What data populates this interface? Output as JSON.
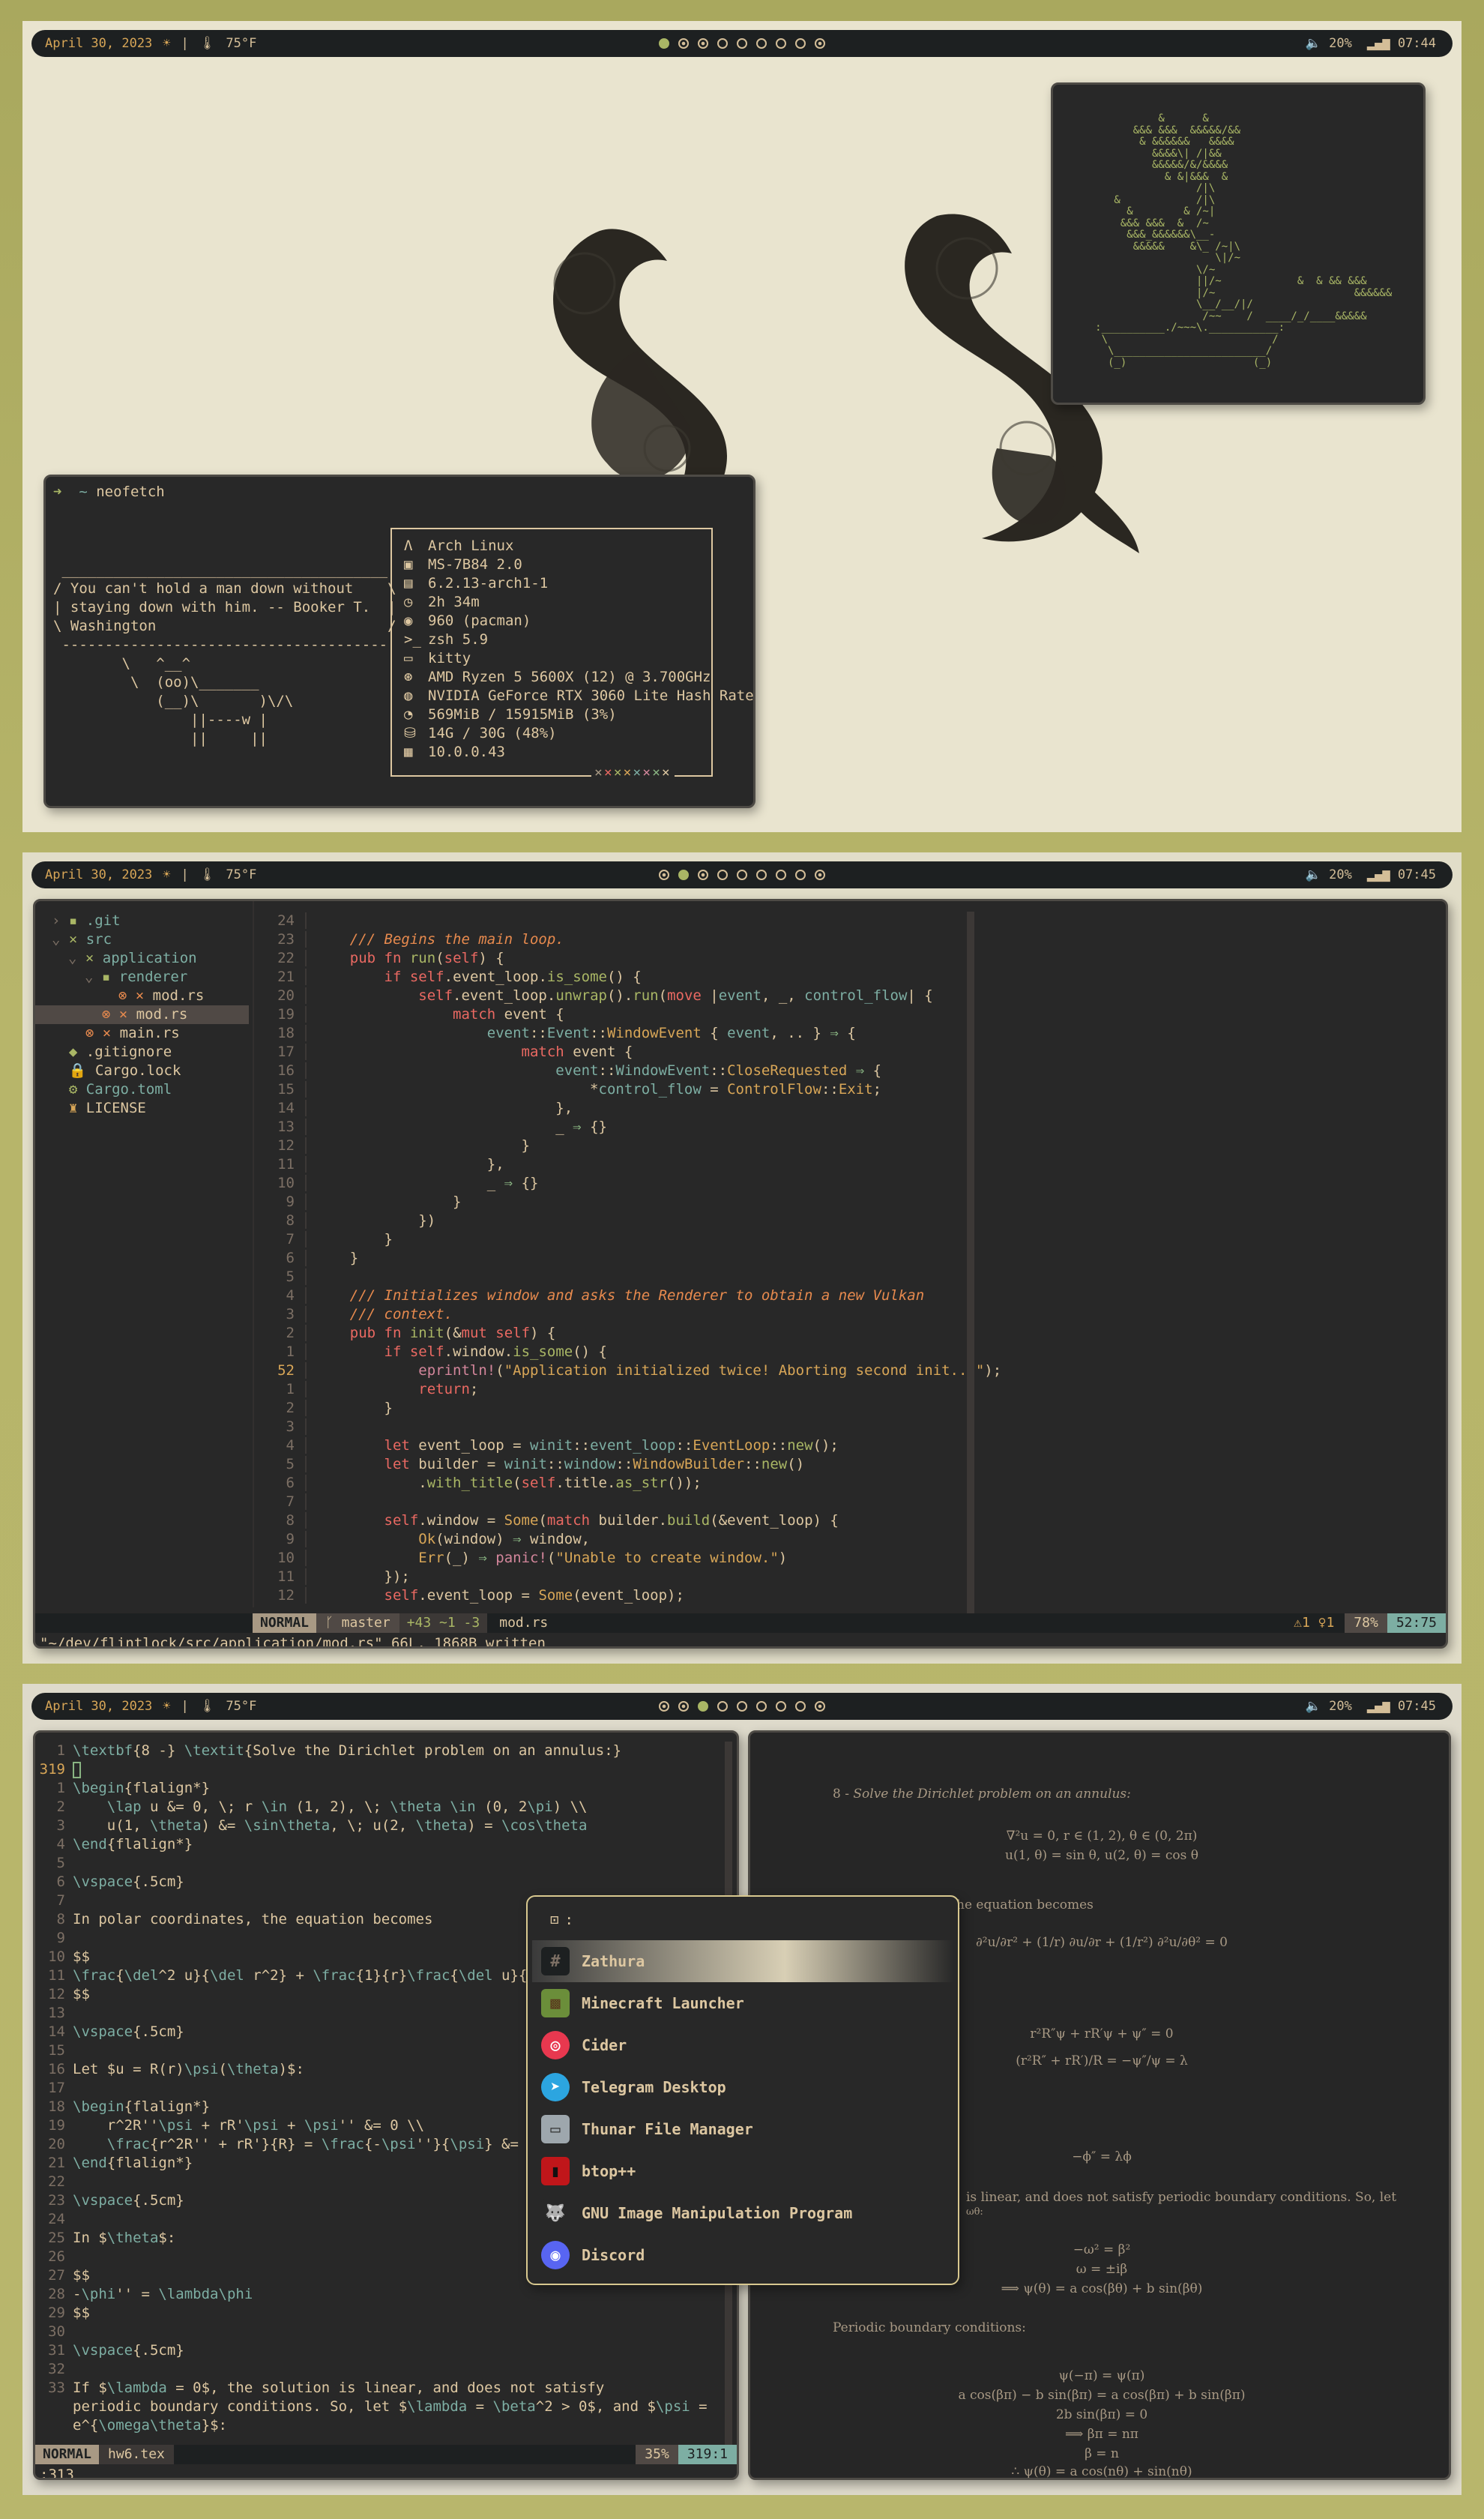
{
  "bar1": {
    "date": "April 30, 2023",
    "temp": "75°F",
    "volume": "20%",
    "time": "07:44"
  },
  "bar2": {
    "date": "April 30, 2023",
    "temp": "75°F",
    "volume": "20%",
    "time": "07:45"
  },
  "bar3": {
    "date": "April 30, 2023",
    "temp": "75°F",
    "volume": "20%",
    "time": "07:45"
  },
  "terminal": {
    "prompt": "➜  ~ neofetch",
    "cowsay": [
      " ______________________________________",
      "/ You can't hold a man down without    \\",
      "| staying down with him. -- Booker T.  |",
      "\\ Washington                           /",
      " --------------------------------------",
      "        \\   ^__^",
      "         \\  (oo)\\_______",
      "            (__)\\       )\\/\\",
      "                ||----w |",
      "                ||     ||"
    ],
    "info": [
      {
        "icon": "arch-icon",
        "glyph": "Λ",
        "text": "Arch Linux"
      },
      {
        "icon": "host-icon",
        "glyph": "▣",
        "text": "MS-7B84 2.0"
      },
      {
        "icon": "kernel-icon",
        "glyph": "▤",
        "text": "6.2.13-arch1-1"
      },
      {
        "icon": "clock-icon",
        "glyph": "◷",
        "text": "2h 34m"
      },
      {
        "icon": "package-icon",
        "glyph": "◉",
        "text": "960 (pacman)"
      },
      {
        "icon": "shell-icon",
        "glyph": ">_",
        "text": "zsh 5.9"
      },
      {
        "icon": "terminal-icon",
        "glyph": "▭",
        "text": "kitty"
      },
      {
        "icon": "cpu-icon",
        "glyph": "⊛",
        "text": "AMD Ryzen 5 5600X (12) @ 3.700GHz"
      },
      {
        "icon": "gpu-icon",
        "glyph": "◍",
        "text": "NVIDIA GeForce RTX 3060 Lite Hash Rate"
      },
      {
        "icon": "memory-icon",
        "glyph": "◔",
        "text": "569MiB / 15915MiB (3%)"
      },
      {
        "icon": "disk-icon",
        "glyph": "⛁",
        "text": "14G / 30G (48%)"
      },
      {
        "icon": "network-icon",
        "glyph": "▦",
        "text": "10.0.0.43"
      }
    ]
  },
  "bonsai": [
    "               &      &",
    "           &&& &&&  &&&&&/&&",
    "            & &&&&&&   &&&&",
    "              &&&&\\| /|&&",
    "              &&&&&/&/&&&&",
    "                & &|&&&  &",
    "                     /|\\",
    "        &            /|\\",
    "          &        & /~|",
    "         &&& &&&  &  /~",
    "          &&&_&&&&&&\\__-",
    "           &&&&&    &\\_ /~|\\",
    "                        \\|/~",
    "                     \\/~",
    "                     ||/~            &  & && &&&",
    "                     |/~                      &&&&&&",
    "                     \\__/__/|/",
    "                      /~~    /  ____/_/____&&&&&",
    "     :__________./~~~\\.___________:",
    "      \\                          /",
    "       \\________________________/",
    "       (_)                    (_)"
  ],
  "editor": {
    "tree": [
      {
        "indent": 1,
        "arrow": "›",
        "icon": "folder-icon",
        "glyph": "▪",
        "label": ".git",
        "color": "#7daea3"
      },
      {
        "indent": 1,
        "arrow": "⌄",
        "icon": "folder-open-icon",
        "glyph": "×",
        "label": "src",
        "color": "#7daea3"
      },
      {
        "indent": 2,
        "arrow": "⌄",
        "icon": "folder-open-icon",
        "glyph": "×",
        "label": "application",
        "color": "#7daea3"
      },
      {
        "indent": 3,
        "arrow": "⌄",
        "icon": "folder-open-icon",
        "glyph": "▪",
        "label": "renderer",
        "color": "#7daea3"
      },
      {
        "indent": 4,
        "arrow": "",
        "icon": "rust-file-icon",
        "glyph": "⊗ ×",
        "label": "mod.rs",
        "color": "#ddc7a1"
      },
      {
        "indent": 3,
        "arrow": "",
        "icon": "rust-file-icon",
        "glyph": "⊗ ×",
        "label": "mod.rs",
        "color": "#ddc7a1",
        "sel": true
      },
      {
        "indent": 2,
        "arrow": "",
        "icon": "rust-file-icon",
        "glyph": "⊗ ×",
        "label": "main.rs",
        "color": "#ddc7a1"
      },
      {
        "indent": 1,
        "arrow": "",
        "icon": "git-icon",
        "glyph": "◆",
        "label": ".gitignore",
        "color": "#ddc7a1"
      },
      {
        "indent": 1,
        "arrow": "",
        "icon": "lock-icon",
        "glyph": "🔒",
        "label": "Cargo.lock",
        "color": "#ddc7a1"
      },
      {
        "indent": 1,
        "arrow": "",
        "icon": "gear-icon",
        "glyph": "⚙",
        "label": "Cargo.toml",
        "color": "#7daea3"
      },
      {
        "indent": 1,
        "arrow": "",
        "icon": "license-icon",
        "glyph": "♜",
        "label": "LICENSE",
        "color": "#ddc7a1"
      }
    ],
    "lines": [
      {
        "n": "24",
        "h": ""
      },
      {
        "n": "23",
        "h": "    <span class='cm'>/// Begins the main loop.</span>"
      },
      {
        "n": "22",
        "h": "    <span class='kw'>pub fn</span> <span class='fn'>run</span>(<span class='kw'>self</span>) {"
      },
      {
        "n": "21",
        "h": "        <span class='kw'>if</span> <span class='kw'>self</span>.event_loop.<span class='fn'>is_some</span>() {"
      },
      {
        "n": "20",
        "h": "            <span class='kw'>self</span>.event_loop.<span class='fn'>unwrap</span>().<span class='fn'>run</span>(<span class='kw'>move</span> |<span class='vr'>event</span>, _, <span class='vr'>control_flow</span>| {"
      },
      {
        "n": "19",
        "h": "                <span class='kw'>match</span> event {"
      },
      {
        "n": "18",
        "h": "                    <span class='vr'>event</span>::<span class='vr'>Event</span>::<span class='ty'>WindowEvent</span> { <span class='vr'>event</span>, .. } <span class='op'>⇒</span> {"
      },
      {
        "n": "17",
        "h": "                        <span class='kw'>match</span> event {"
      },
      {
        "n": "16",
        "h": "                            <span class='vr'>event</span>::<span class='vr'>WindowEvent</span>::<span class='ty'>CloseRequested</span> <span class='op'>⇒</span> {"
      },
      {
        "n": "15",
        "h": "                                *<span class='vr'>control_flow</span> = <span class='ty'>ControlFlow</span>::<span class='ty'>Exit</span>;"
      },
      {
        "n": "14",
        "h": "                            },"
      },
      {
        "n": "13",
        "h": "                            _ <span class='op'>⇒</span> {}"
      },
      {
        "n": "12",
        "h": "                        }"
      },
      {
        "n": "11",
        "h": "                    },"
      },
      {
        "n": "10",
        "h": "                    _ <span class='op'>⇒</span> {}"
      },
      {
        "n": "9",
        "h": "                }"
      },
      {
        "n": "8",
        "h": "            })"
      },
      {
        "n": "7",
        "h": "        }"
      },
      {
        "n": "6",
        "h": "    }"
      },
      {
        "n": "5",
        "h": ""
      },
      {
        "n": "4",
        "h": "    <span class='cm'>/// Initializes window and asks the Renderer to obtain a new Vulkan</span>"
      },
      {
        "n": "3",
        "h": "    <span class='cm'>/// context.</span>"
      },
      {
        "n": "2",
        "h": "    <span class='kw'>pub fn</span> <span class='fn'>init</span>(&amp;<span class='kw'>mut self</span>) {"
      },
      {
        "n": "1",
        "h": "        <span class='kw'>if</span> <span class='kw'>self</span>.window.<span class='fn'>is_some</span>() {"
      },
      {
        "n": "52",
        "h": "            <span class='mac'>eprintln!</span>(<span class='st'>\"Application initialized twice! Aborting second init...\"</span>);",
        "cur": true
      },
      {
        "n": "1",
        "h": "            <span class='kw'>return</span>;"
      },
      {
        "n": "2",
        "h": "        }"
      },
      {
        "n": "3",
        "h": ""
      },
      {
        "n": "4",
        "h": "        <span class='kw'>let</span> event_loop = <span class='vr'>winit</span>::<span class='vr'>event_loop</span>::<span class='ty'>EventLoop</span>::<span class='fn'>new</span>();"
      },
      {
        "n": "5",
        "h": "        <span class='kw'>let</span> builder = <span class='vr'>winit</span>::<span class='vr'>window</span>::<span class='ty'>WindowBuilder</span>::<span class='fn'>new</span>()"
      },
      {
        "n": "6",
        "h": "            .<span class='fn'>with_title</span>(<span class='kw'>self</span>.title.<span class='fn'>as_str</span>());"
      },
      {
        "n": "7",
        "h": ""
      },
      {
        "n": "8",
        "h": "        <span class='kw'>self</span>.window = <span class='ty'>Some</span>(<span class='kw'>match</span> builder.<span class='fn'>build</span>(&amp;event_loop) {"
      },
      {
        "n": "9",
        "h": "            <span class='ty'>Ok</span>(window) <span class='op'>⇒</span> window,"
      },
      {
        "n": "10",
        "h": "            <span class='ty'>Err</span>(_) <span class='op'>⇒</span> <span class='mac'>panic!</span>(<span class='st'>\"Unable to create window.\"</span>)"
      },
      {
        "n": "11",
        "h": "        });"
      },
      {
        "n": "12",
        "h": "        <span class='kw'>self</span>.event_loop = <span class='ty'>Some</span>(event_loop);"
      }
    ],
    "mode": "NORMAL",
    "branch": "master",
    "diff": "+43 ~1 -3",
    "file": "mod.rs",
    "diagnostics": "⚠1 ♀1",
    "percent": "78%",
    "position": "52:75",
    "message": "\"~/dev/flintlock/src/application/mod.rs\" 66L, 1868B written"
  },
  "tex": {
    "lines": [
      {
        "n": "1",
        "t": "\\textbf{8 -} \\textit{Solve the Dirichlet problem on an annulus:}"
      },
      {
        "n": "319",
        "t": "",
        "cur": true
      },
      {
        "n": "1",
        "t": "\\begin{flalign*}"
      },
      {
        "n": "2",
        "t": "    \\lap u &= 0, \\; r \\in (1, 2), \\; \\theta \\in (0, 2\\pi) \\\\"
      },
      {
        "n": "3",
        "t": "    u(1, \\theta) &= \\sin\\theta, \\; u(2, \\theta) = \\cos\\theta"
      },
      {
        "n": "4",
        "t": "\\end{flalign*}"
      },
      {
        "n": "5",
        "t": ""
      },
      {
        "n": "6",
        "t": "\\vspace{.5cm}"
      },
      {
        "n": "7",
        "t": ""
      },
      {
        "n": "8",
        "t": "In polar coordinates, the equation becomes"
      },
      {
        "n": "9",
        "t": ""
      },
      {
        "n": "10",
        "t": "$$"
      },
      {
        "n": "11",
        "t": "\\frac{\\del^2 u}{\\del r^2} + \\frac{1}{r}\\frac{\\del u}{\\del"
      },
      {
        "n": "12",
        "t": "$$"
      },
      {
        "n": "13",
        "t": ""
      },
      {
        "n": "14",
        "t": "\\vspace{.5cm}"
      },
      {
        "n": "15",
        "t": ""
      },
      {
        "n": "16",
        "t": "Let $u = R(r)\\psi(\\theta)$:"
      },
      {
        "n": "17",
        "t": ""
      },
      {
        "n": "18",
        "t": "\\begin{flalign*}"
      },
      {
        "n": "19",
        "t": "    r^2R''\\psi + rR'\\psi + \\psi'' &= 0 \\\\"
      },
      {
        "n": "20",
        "t": "    \\frac{r^2R'' + rR'}{R} = \\frac{-\\psi''}{\\psi} &= \\l"
      },
      {
        "n": "21",
        "t": "\\end{flalign*}"
      },
      {
        "n": "22",
        "t": ""
      },
      {
        "n": "23",
        "t": "\\vspace{.5cm}"
      },
      {
        "n": "24",
        "t": ""
      },
      {
        "n": "25",
        "t": "In $\\theta$:"
      },
      {
        "n": "26",
        "t": ""
      },
      {
        "n": "27",
        "t": "$$"
      },
      {
        "n": "28",
        "t": "-\\phi'' = \\lambda\\phi"
      },
      {
        "n": "29",
        "t": "$$"
      },
      {
        "n": "30",
        "t": ""
      },
      {
        "n": "31",
        "t": "\\vspace{.5cm}"
      },
      {
        "n": "32",
        "t": ""
      },
      {
        "n": "33",
        "t": "If $\\lambda = 0$, the solution is linear, and does not satisfy"
      },
      {
        "n": "",
        "t": "periodic boundary conditions. So, let $\\lambda = \\beta^2 > 0$, and $\\psi ="
      },
      {
        "n": "",
        "t": "e^{\\omega\\theta}$:"
      }
    ],
    "mode": "NORMAL",
    "file": "hw6.tex",
    "percent": "35%",
    "position": "319:1",
    "cmdline": ":313"
  },
  "launcher": {
    "prompt_icon": "⊡",
    "prompt": ":",
    "items": [
      {
        "label": "Zathura",
        "icon": "zathura-icon",
        "glyph": "#",
        "bg": "#1d2021",
        "fg": "#7c6f64"
      },
      {
        "label": "Minecraft Launcher",
        "icon": "minecraft-icon",
        "glyph": "▩",
        "bg": "#6b8e3a",
        "fg": "#5a3b1e"
      },
      {
        "label": "Cider",
        "icon": "cider-icon",
        "glyph": "◎",
        "bg": "#e8384f",
        "fg": "#fff"
      },
      {
        "label": "Telegram Desktop",
        "icon": "telegram-icon",
        "glyph": "➤",
        "bg": "#2ca5e0",
        "fg": "#fff"
      },
      {
        "label": "Thunar File Manager",
        "icon": "thunar-icon",
        "glyph": "▭",
        "bg": "#9ea7ad",
        "fg": "#333"
      },
      {
        "label": "btop++",
        "icon": "btop-icon",
        "glyph": "▮",
        "bg": "#c0161a",
        "fg": "#111"
      },
      {
        "label": "GNU Image Manipulation Program",
        "icon": "gimp-icon",
        "glyph": "🐺",
        "bg": "#282828",
        "fg": "#ccc"
      },
      {
        "label": "Discord",
        "icon": "discord-icon",
        "glyph": "◉",
        "bg": "#5865f2",
        "fg": "#fff"
      }
    ]
  },
  "pdf": {
    "problem_num": "8 -",
    "problem": "Solve the Dirichlet problem on an annulus:",
    "eq1": "∇²u = 0,  r ∈ (1, 2),  θ ∈ (0, 2π)",
    "eq2": "u(1, θ) = sin θ,  u(2, θ) = cos θ",
    "polar": "he equation becomes",
    "eq3": "∂²u/∂r² + (1/r) ∂u/∂r + (1/r²) ∂²u/∂θ² = 0",
    "eq4": "r²R″ψ + rR′ψ + ψ″ = 0",
    "eq5": "(r²R″ + rR′)/R = −ψ″/ψ = λ",
    "eq6": "−ϕ″ = λϕ",
    "linear": "is linear, and does not satisfy periodic boundary conditions. So, let",
    "linear2": "ωθ:",
    "eq7": "−ω² = β²",
    "eq8": "ω = ±iβ",
    "eq9": "⟹  ψ(θ) = a cos(βθ) + b sin(βθ)",
    "periodic": "Periodic boundary conditions:",
    "eq10": "ψ(−π) = ψ(π)",
    "eq11": "a cos(βπ) − b sin(βπ) = a cos(βπ) + b sin(βπ)",
    "eq12": "2b sin(βπ) = 0",
    "eq13": "⟹  βπ = nπ",
    "eq14": "β = n",
    "eq15": "∴ ψ(θ) = a cos(nθ) + sin(nθ)"
  }
}
